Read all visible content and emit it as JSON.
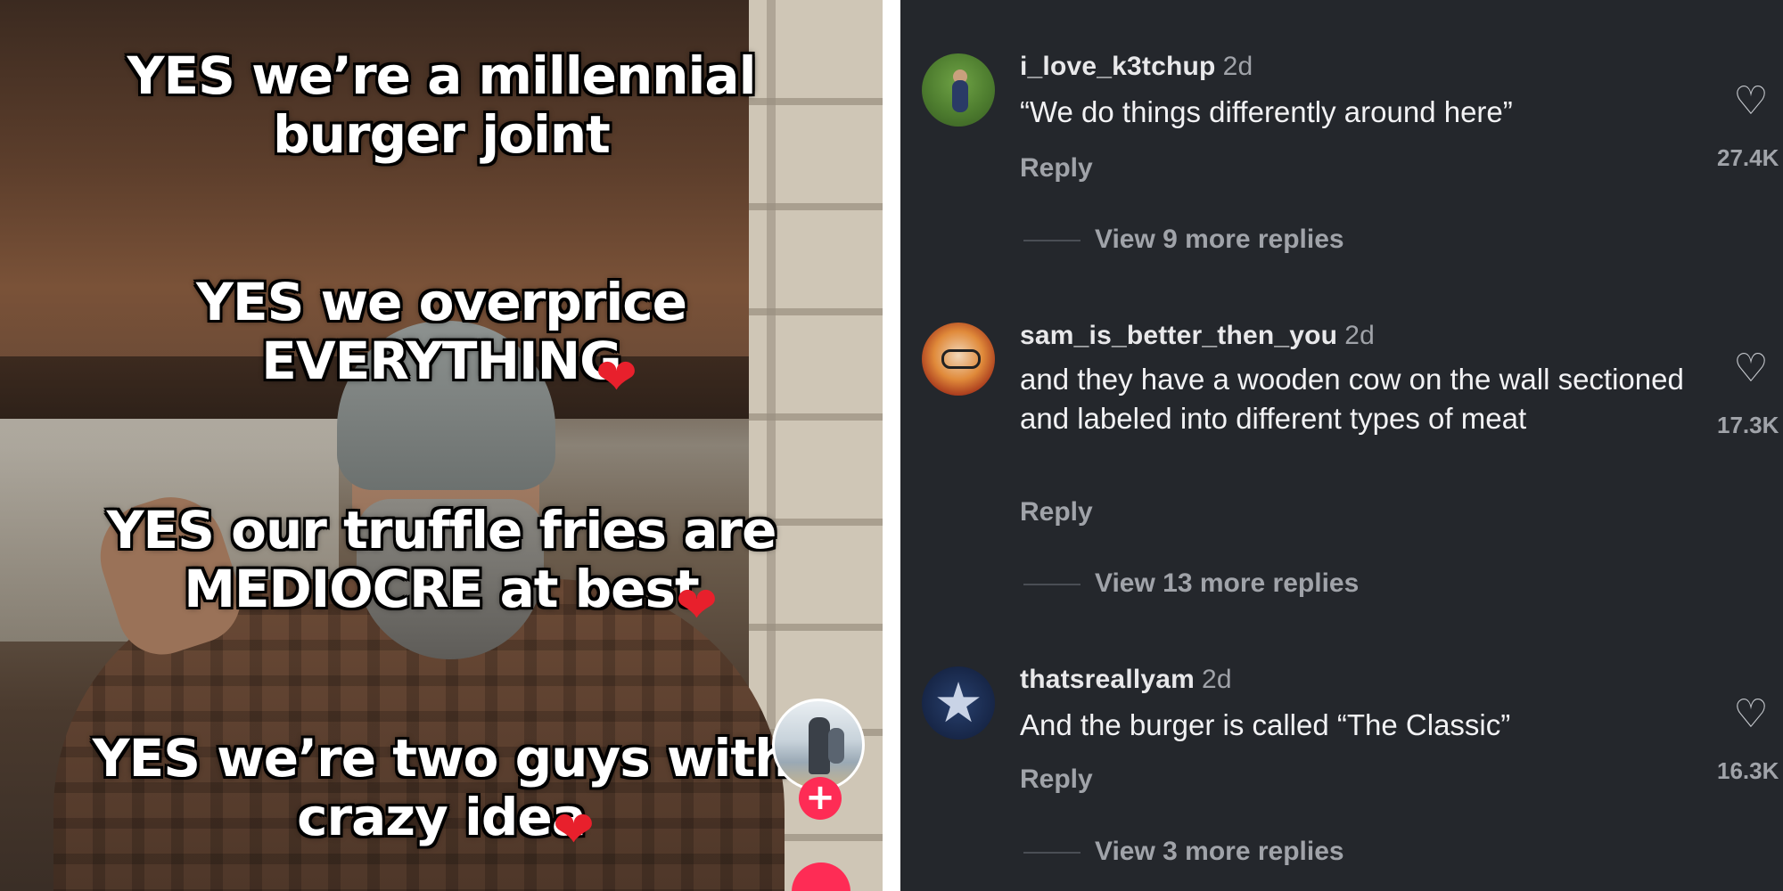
{
  "video": {
    "captions": [
      {
        "text": "YES we’re a millennial burger joint",
        "heart": false
      },
      {
        "text": "YES we overprice EVERYTHING",
        "heart": true
      },
      {
        "text": "YES our truffle fries are MEDIOCRE at best",
        "heart": true
      },
      {
        "text": "YES we’re two guys with crazy idea",
        "heart": true
      }
    ],
    "heart_glyph": "❤",
    "follow_label": "+",
    "accent_color": "#fe2c55"
  },
  "comments": [
    {
      "username": "i_love_k3tchup",
      "age": "2d",
      "text": "“We do things differently around here”",
      "reply_label": "Reply",
      "like_count": "27.4K",
      "view_replies": "View 9 more replies"
    },
    {
      "username": "sam_is_better_then_you",
      "age": "2d",
      "text": "and they have a wooden cow on the wall sectioned and labeled into different types of meat",
      "reply_label": "Reply",
      "like_count": "17.3K",
      "view_replies": "View 13 more replies"
    },
    {
      "username": "thatsreallyam",
      "age": "2d",
      "text": "And the burger is called “The Classic”",
      "reply_label": "Reply",
      "like_count": "16.3K",
      "view_replies": "View 3 more replies"
    }
  ],
  "icons": {
    "like": "heart-outline-icon",
    "star": "★"
  },
  "colors": {
    "comments_bg": "#24272c",
    "caption_heart": "#e8202c"
  }
}
